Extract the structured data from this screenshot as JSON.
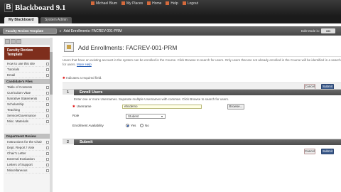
{
  "app": {
    "logo_mark": "B",
    "logo_text": "Blackboard 9.1"
  },
  "toplinks": [
    "Michael Blum",
    "My Places",
    "Home",
    "Help",
    "Logout"
  ],
  "tabs": {
    "active": "My Blackboard",
    "other": "System Admin"
  },
  "course_menu_button": "Faculty Review Template",
  "breadcrumb": {
    "sep": "▸",
    "item": "Add Enrollments: FACREV-001-PRM"
  },
  "edit_mode": {
    "label": "Edit Mode is:",
    "state": "ON"
  },
  "sidebar": {
    "course_title": "Faculty Review Template",
    "sections": [
      {
        "label": "Candidate's Files",
        "items": [
          "Table of Contents",
          "Curriculum Vitae",
          "Narrative Statements",
          "Scholarship",
          "Teaching",
          "Service/Governance",
          "Misc. Materials"
        ]
      },
      {
        "label": "Department Review",
        "items": [
          "Instructions for the Chair",
          "Dept. Report / Vote",
          "Chair's Letter",
          "External Evaluation",
          "Letters of Support",
          "Miscellaneous"
        ]
      }
    ],
    "top_items": [
      "How to use this site",
      "Tutorials",
      "Email"
    ]
  },
  "main": {
    "title": "Add Enrollments: FACREV-001-PRM",
    "intro": "Users that have an existing account in the system can be enrolled in the Course. Click Browse to search for users. Only users that are not already enrolled in the Course will be identified in a search for users.",
    "more_help": "More Help",
    "required_note": "Indicates a required field.",
    "cancel": "Cancel",
    "submit": "Submit",
    "step1": {
      "num": "1",
      "title": "Enroll Users",
      "desc": "Enter one or more Usernames. Separate multiple Usernames with commas. Click Browse to search for users."
    },
    "username": {
      "label": "Username",
      "value": "ebcdemo"
    },
    "browse": "Browse...",
    "role": {
      "label": "Role",
      "value": "Student"
    },
    "availability": {
      "label": "Enrollment Availability",
      "yes": "Yes",
      "no": "No"
    },
    "step2": {
      "num": "2",
      "title": "Submit"
    }
  }
}
